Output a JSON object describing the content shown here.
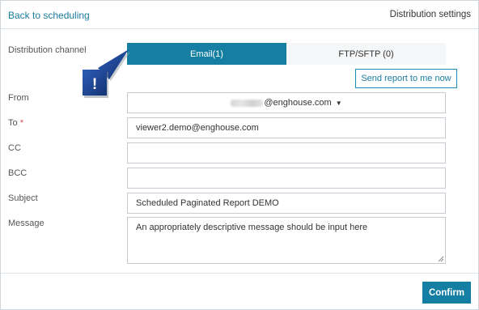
{
  "header": {
    "back_link": "Back to scheduling",
    "title": "Distribution settings"
  },
  "distribution": {
    "label": "Distribution channel",
    "tabs": [
      {
        "label": "Email(1)",
        "active": true
      },
      {
        "label": "FTP/SFTP (0)",
        "active": false
      }
    ],
    "send_to_me": "Send report to me now"
  },
  "callout": {
    "symbol": "!",
    "color": "#1a3f8f"
  },
  "form": {
    "from": {
      "label": "From",
      "value": "@enghouse.com",
      "icon": "caret-down-icon"
    },
    "to": {
      "label": "To",
      "required_mark": "*",
      "value": "viewer2.demo@enghouse.com"
    },
    "cc": {
      "label": "CC",
      "value": ""
    },
    "bcc": {
      "label": "BCC",
      "value": ""
    },
    "subject": {
      "label": "Subject",
      "value": "Scheduled Paginated Report DEMO"
    },
    "message": {
      "label": "Message",
      "value": "An appropriately descriptive message should be input here"
    }
  },
  "footer": {
    "confirm_label": "Confirm"
  },
  "colors": {
    "accent": "#147ea3",
    "link": "#1b7ca0",
    "required": "#d9534f"
  }
}
